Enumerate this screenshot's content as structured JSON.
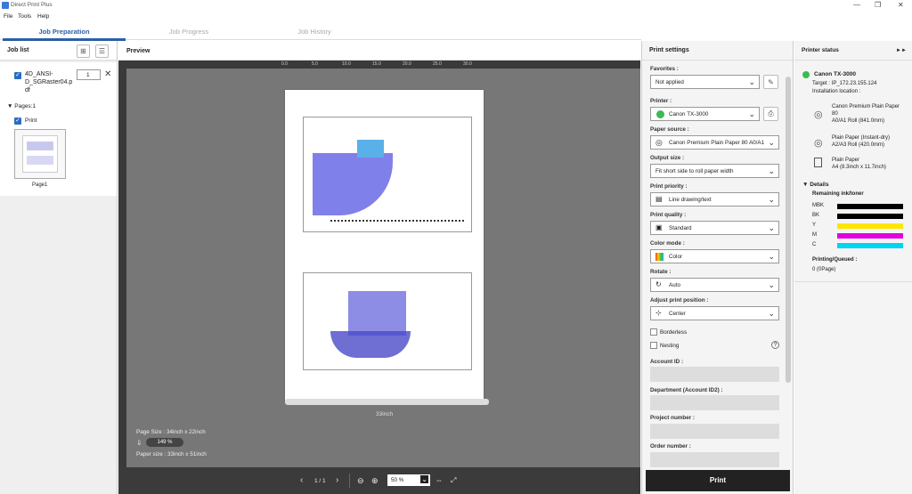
{
  "window": {
    "title": "Direct Print Plus",
    "minimize": "—",
    "restore": "❐",
    "close": "✕"
  },
  "menu": [
    "File",
    "Tools",
    "Help"
  ],
  "tabs": [
    {
      "label": "Job Preparation"
    },
    {
      "label": "Job Progress"
    },
    {
      "label": "Job History"
    }
  ],
  "job_list": {
    "header": "Job list",
    "file_name_lines": [
      "4D_ANSI-",
      "D_SGRaster04.p",
      "df"
    ],
    "copies": "1",
    "pages_label": "Pages:1",
    "print_label": "Print",
    "thumb_label": "Page1"
  },
  "preview": {
    "header": "Preview",
    "ruler_marks": [
      "0.0",
      "5.0",
      "10.0",
      "15.0",
      "20.0",
      "25.0",
      "30.0"
    ],
    "width_label": "33inch",
    "page_size": "Page Size : 34inch x 22inch",
    "zoom_badge": "149 %",
    "paper_size": "Paper size : 33inch x 51inch",
    "page_indicator": "1 / 1",
    "zoom_select": "50 %"
  },
  "print_settings": {
    "header": "Print settings",
    "favorites": {
      "label": "Favorites :",
      "value": "Not applied"
    },
    "printer": {
      "label": "Printer :",
      "value": "Canon TX-3000"
    },
    "paper_source": {
      "label": "Paper source :",
      "value": "Canon Premium Plain Paper 80 A0/A1"
    },
    "output_size": {
      "label": "Output size :",
      "value": "Fit short side to roll paper width"
    },
    "print_priority": {
      "label": "Print priority :",
      "value": "Line drawing/text"
    },
    "print_quality": {
      "label": "Print quality :",
      "value": "Standard"
    },
    "color_mode": {
      "label": "Color mode :",
      "value": "Color"
    },
    "rotate": {
      "label": "Rotate :",
      "value": "Auto"
    },
    "adjust_position": {
      "label": "Adjust print position :",
      "value": "Center"
    },
    "borderless": "Borderless",
    "nesting": "Nesting",
    "account_id": "Account ID :",
    "department": "Department (Account ID2) :",
    "project_number": "Project number :",
    "order_number": "Order number :",
    "print_button": "Print"
  },
  "printer_status": {
    "header": "Printer status",
    "expand": "►►",
    "printer_name": "Canon TX-3000",
    "target": "Target : IP_172.23.155.124",
    "installation": "Installation location :",
    "media": [
      {
        "lines": [
          "Canon Premium Plain Paper",
          "80",
          "A0/A1 Roll (841.0mm)"
        ]
      },
      {
        "lines": [
          "Plain Paper (Instant-dry)",
          "A2/A3 Roll (420.0mm)"
        ]
      },
      {
        "lines": [
          "Plain Paper",
          "A4 (8.3inch x 11.7inch)"
        ]
      }
    ],
    "details": "Details",
    "remaining": "Remaining ink/toner",
    "inks": [
      {
        "name": "MBK",
        "color": "#000000"
      },
      {
        "name": "BK",
        "color": "#000000"
      },
      {
        "name": "Y",
        "color": "#ffe600"
      },
      {
        "name": "M",
        "color": "#e000e0"
      },
      {
        "name": "C",
        "color": "#00d4f0"
      }
    ],
    "queued_label": "Printing/Queued :",
    "queued_value": "0 (0Page)"
  }
}
